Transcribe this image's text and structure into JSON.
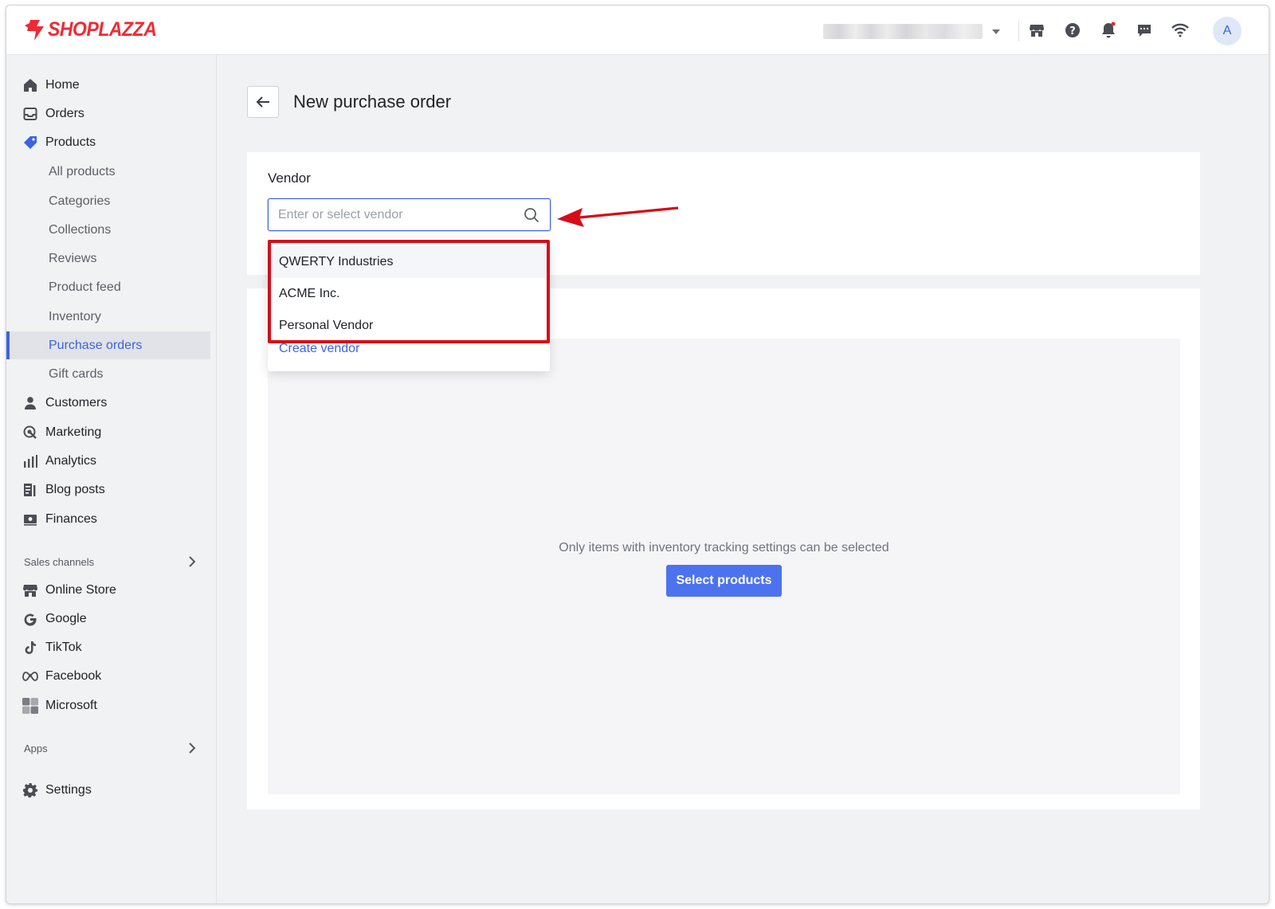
{
  "brand": {
    "name": "SHOPLAZZA",
    "logo_color": "#ee2b35"
  },
  "topbar": {
    "icons": [
      "storefront-icon",
      "help-icon",
      "notification-icon",
      "message-icon",
      "wifi-icon"
    ],
    "avatar_initial": "A"
  },
  "sidebar": {
    "items": [
      {
        "label": "Home",
        "icon": "home-icon"
      },
      {
        "label": "Orders",
        "icon": "orders-icon"
      },
      {
        "label": "Products",
        "icon": "tag-icon"
      },
      {
        "label": "Customers",
        "icon": "person-icon"
      },
      {
        "label": "Marketing",
        "icon": "marketing-icon"
      },
      {
        "label": "Analytics",
        "icon": "bar-chart-icon"
      },
      {
        "label": "Blog posts",
        "icon": "blog-icon"
      },
      {
        "label": "Finances",
        "icon": "finances-icon"
      }
    ],
    "products_sub": [
      {
        "label": "All products"
      },
      {
        "label": "Categories"
      },
      {
        "label": "Collections"
      },
      {
        "label": "Reviews"
      },
      {
        "label": "Product feed"
      },
      {
        "label": "Inventory"
      },
      {
        "label": "Purchase orders",
        "active": true
      },
      {
        "label": "Gift cards"
      }
    ],
    "sales_channels_header": "Sales channels",
    "channels": [
      {
        "label": "Online Store",
        "icon": "store-icon"
      },
      {
        "label": "Google",
        "icon": "google-icon"
      },
      {
        "label": "TikTok",
        "icon": "tiktok-icon"
      },
      {
        "label": "Facebook",
        "icon": "meta-icon"
      },
      {
        "label": "Microsoft",
        "icon": "microsoft-icon"
      }
    ],
    "apps_header": "Apps",
    "settings_label": "Settings"
  },
  "page": {
    "title": "New purchase order",
    "vendor_label": "Vendor",
    "vendor_placeholder": "Enter or select vendor",
    "vendor_options": [
      "QWERTY Industries",
      "ACME Inc.",
      "Personal Vendor"
    ],
    "create_vendor": "Create vendor",
    "empty_message": "Only items with inventory tracking settings can be selected",
    "select_products_label": "Select products"
  },
  "colors": {
    "accent": "#3d63dd",
    "button": "#4c72ee",
    "highlight": "#d60c18"
  }
}
